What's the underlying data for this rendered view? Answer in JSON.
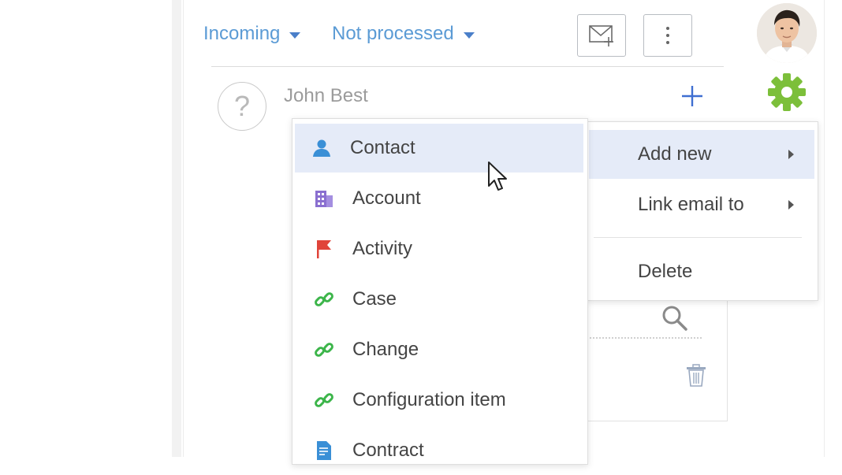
{
  "filters": {
    "direction": "Incoming",
    "status": "Not processed"
  },
  "email": {
    "sender": "John Best"
  },
  "context_menu": {
    "add_new": "Add new",
    "link_email_to": "Link email to",
    "delete": "Delete"
  },
  "add_new_submenu": {
    "items": [
      {
        "label": "Contact",
        "icon": "person-icon",
        "color": "#3a8fd6"
      },
      {
        "label": "Account",
        "icon": "building-icon",
        "color": "#8a6fd0"
      },
      {
        "label": "Activity",
        "icon": "flag-icon",
        "color": "#e0443a"
      },
      {
        "label": "Case",
        "icon": "link-icon",
        "color": "#3cb54a"
      },
      {
        "label": "Change",
        "icon": "link-icon",
        "color": "#3cb54a"
      },
      {
        "label": "Configuration item",
        "icon": "link-icon",
        "color": "#3cb54a"
      },
      {
        "label": "Contract",
        "icon": "document-icon",
        "color": "#3a8fd6"
      }
    ]
  },
  "colors": {
    "accent": "#5b9bd5",
    "highlight": "#e5ebf8",
    "gear": "#7cbf3a"
  }
}
